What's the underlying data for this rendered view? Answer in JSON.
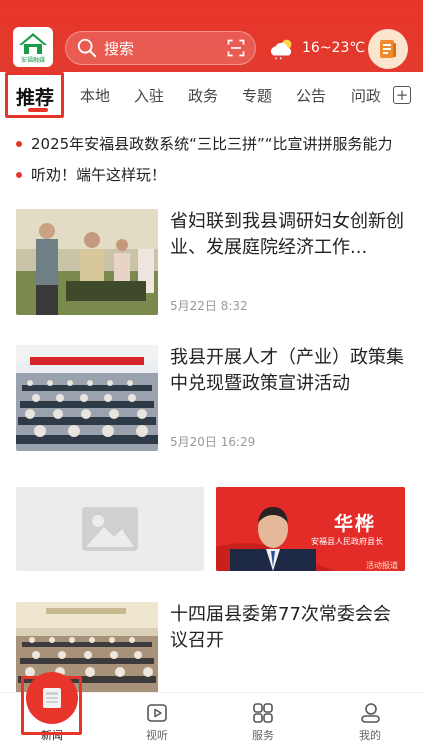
{
  "header": {
    "logo_text": "安福融媒",
    "search_placeholder": "搜索",
    "weather": "16~23℃",
    "icons": [
      "search-icon",
      "scan-icon",
      "cloud-sun-icon",
      "user-book-icon"
    ]
  },
  "tabs": {
    "items": [
      "推荐",
      "本地",
      "入驻",
      "政务",
      "专题",
      "公告",
      "问政"
    ],
    "active": "推荐"
  },
  "headlines": [
    "2025年安福县政数系统“三比三拼”“比宣讲拼服务能力",
    "听劝！端午这样玩！"
  ],
  "news": [
    {
      "title": "省妇联到我县调研妇女创新创业、发展庭院经济工作...",
      "date": "5月22日 8:32"
    },
    {
      "title": "我县开展人才（产业）政策集中兑现暨政策宣讲活动",
      "date": "5月20日 16:29"
    },
    {
      "title": "十四届县委第77次常委会会议召开",
      "date": ""
    }
  ],
  "banner": {
    "name": "华桦",
    "subtitle": "安福县人民政府县长",
    "tag": "活动报道集"
  },
  "bottom_nav": [
    {
      "label": "新闻",
      "icon": "news-icon",
      "active": true
    },
    {
      "label": "视听",
      "icon": "play-icon",
      "active": false
    },
    {
      "label": "服务",
      "icon": "grid-icon",
      "active": false
    },
    {
      "label": "我的",
      "icon": "person-icon",
      "active": false
    }
  ],
  "colors": {
    "brand": "#e8352b",
    "text": "#222222",
    "meta": "#999999"
  }
}
